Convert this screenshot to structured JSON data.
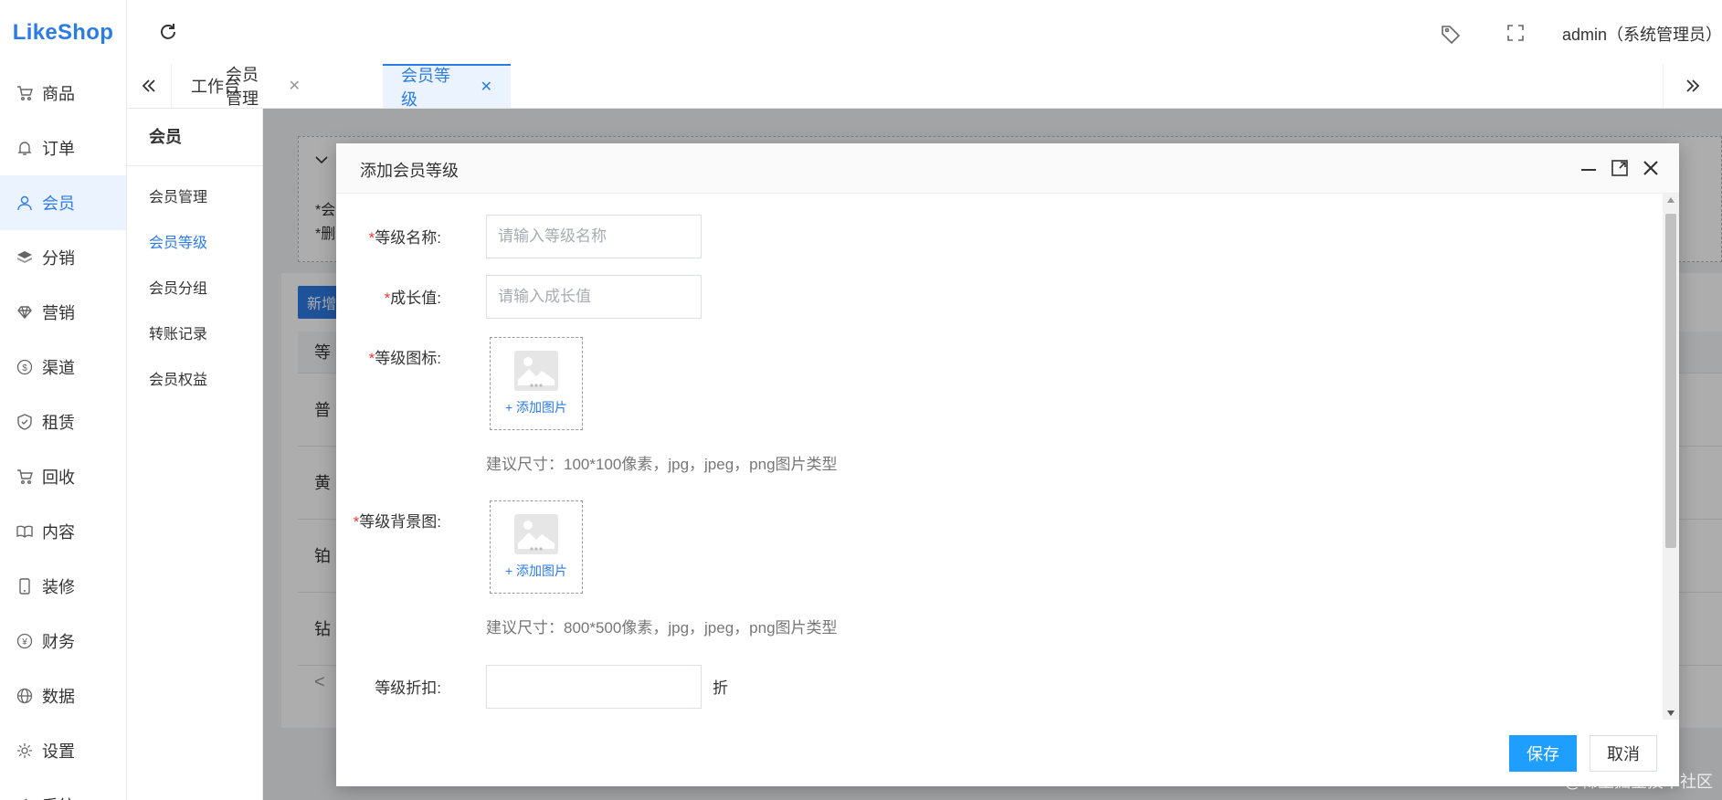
{
  "brand": {
    "logo": "LikeShop"
  },
  "sidebar": {
    "items": [
      {
        "label": "商品",
        "icon": "cart-icon"
      },
      {
        "label": "订单",
        "icon": "bell-icon"
      },
      {
        "label": "会员",
        "icon": "user-icon",
        "active": true
      },
      {
        "label": "分销",
        "icon": "layers-icon"
      },
      {
        "label": "营销",
        "icon": "diamond-icon"
      },
      {
        "label": "渠道",
        "icon": "dollar-circle-icon"
      },
      {
        "label": "租赁",
        "icon": "shield-check-icon"
      },
      {
        "label": "回收",
        "icon": "cart-icon"
      },
      {
        "label": "内容",
        "icon": "book-icon"
      },
      {
        "label": "装修",
        "icon": "phone-icon"
      },
      {
        "label": "财务",
        "icon": "yen-circle-icon"
      },
      {
        "label": "数据",
        "icon": "globe-icon"
      },
      {
        "label": "设置",
        "icon": "gear-icon"
      },
      {
        "label": "系统",
        "icon": "tools-icon"
      }
    ]
  },
  "header": {
    "user": "admin（系统管理员）"
  },
  "tabs": [
    {
      "label": "工作台"
    },
    {
      "label": "会员管理"
    },
    {
      "label": "会员等级",
      "active": true
    }
  ],
  "submenu": {
    "title": "会员",
    "items": [
      {
        "label": "会员管理"
      },
      {
        "label": "会员等级",
        "active": true
      },
      {
        "label": "会员分组"
      },
      {
        "label": "转账记录"
      },
      {
        "label": "会员权益"
      }
    ]
  },
  "background_page": {
    "tips": [
      "*会",
      "*删"
    ],
    "new_button": "新增",
    "table_header": "等",
    "rows": [
      "普",
      "黄",
      "铂",
      "钻"
    ],
    "pager_prev": "<"
  },
  "modal": {
    "title": "添加会员等级",
    "fields": {
      "name": {
        "label": "等级名称:",
        "placeholder": "请输入等级名称"
      },
      "growth": {
        "label": "成长值:",
        "placeholder": "请输入成长值"
      },
      "icon": {
        "label": "等级图标:",
        "upload_text": "+ 添加图片",
        "hint": "建议尺寸：100*100像素，jpg，jpeg，png图片类型"
      },
      "background": {
        "label": "等级背景图:",
        "upload_text": "+ 添加图片",
        "hint": "建议尺寸：800*500像素，jpg，jpeg，png图片类型"
      },
      "discount": {
        "label": "等级折扣:",
        "value": "",
        "unit": "折"
      }
    },
    "required_mark": "*",
    "save": "保存",
    "cancel": "取消"
  },
  "watermark": "@稀土掘金技术社区",
  "colors": {
    "accent": "#2d7be5",
    "primary_button": "#1e9fff",
    "required": "#e53935"
  }
}
